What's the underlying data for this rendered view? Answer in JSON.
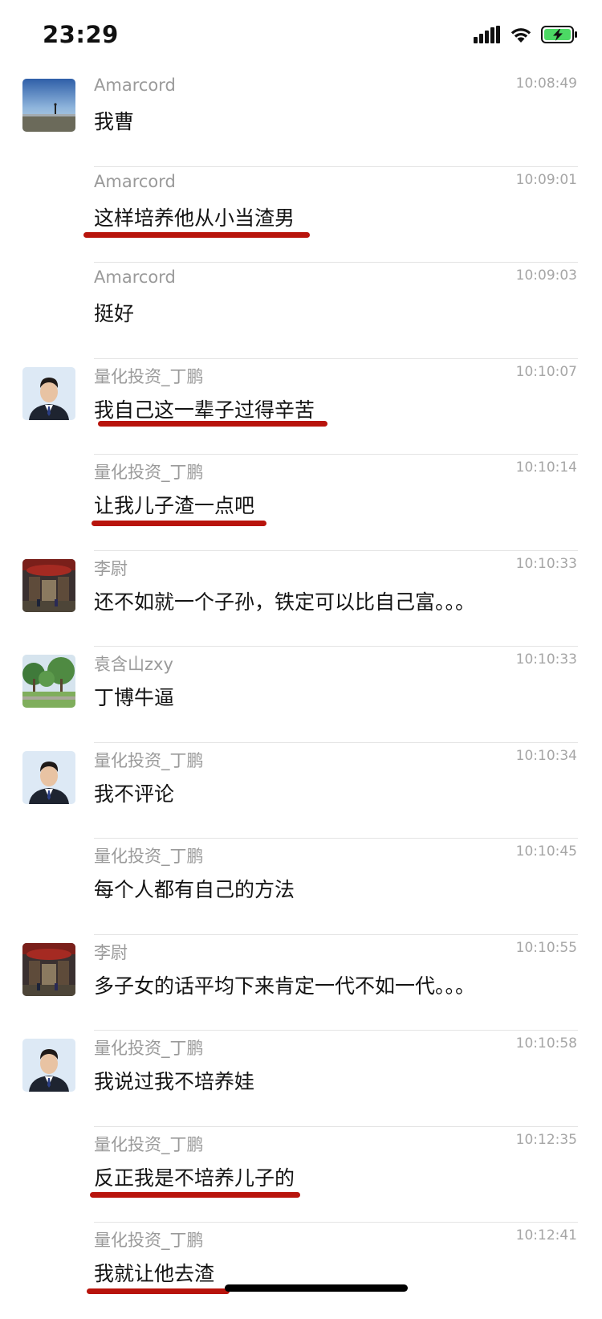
{
  "status_bar": {
    "time": "23:29"
  },
  "messages": [
    {
      "sender": "Amarcord",
      "time": "10:08:49",
      "text": "我曹"
    },
    {
      "sender": "Amarcord",
      "time": "10:09:01",
      "text": "这样培养他从小当渣男"
    },
    {
      "sender": "Amarcord",
      "time": "10:09:03",
      "text": "挺好"
    },
    {
      "sender": "量化投资_丁鹏",
      "time": "10:10:07",
      "text": "我自己这一辈子过得辛苦"
    },
    {
      "sender": "量化投资_丁鹏",
      "time": "10:10:14",
      "text": "让我儿子渣一点吧"
    },
    {
      "sender": "李尉",
      "time": "10:10:33",
      "text": "还不如就一个子孙，铁定可以比自己富。。。"
    },
    {
      "sender": "袁含山zxy",
      "time": "10:10:33",
      "text": "丁博牛逼"
    },
    {
      "sender": "量化投资_丁鹏",
      "time": "10:10:34",
      "text": "我不评论"
    },
    {
      "sender": "量化投资_丁鹏",
      "time": "10:10:45",
      "text": "每个人都有自己的方法"
    },
    {
      "sender": "李尉",
      "time": "10:10:55",
      "text": "多子女的话平均下来肯定一代不如一代。。。"
    },
    {
      "sender": "量化投资_丁鹏",
      "time": "10:10:58",
      "text": "我说过我不培养娃"
    },
    {
      "sender": "量化投资_丁鹏",
      "time": "10:12:35",
      "text": "反正我是不培养儿子的"
    },
    {
      "sender": "量化投资_丁鹏",
      "time": "10:12:41",
      "text": "我就让他去渣"
    }
  ],
  "colors": {
    "underline_annotation": "#b8140c",
    "sender": "#9a9a9a",
    "timestamp": "#a6a6a6",
    "battery_fill": "#4cd964"
  }
}
